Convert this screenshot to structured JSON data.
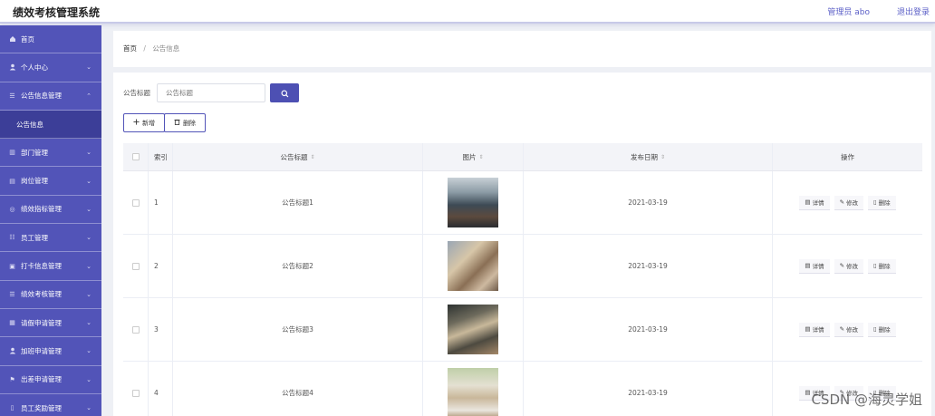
{
  "header": {
    "title": "绩效考核管理系统",
    "admin_text": "管理员 abo",
    "logout_label": "退出登录"
  },
  "sidebar": {
    "items": [
      {
        "label": "首页",
        "icon": "home-icon",
        "has_arrow": false,
        "sub": false
      },
      {
        "label": "个人中心",
        "icon": "user-icon",
        "has_arrow": true,
        "sub": false
      },
      {
        "label": "公告信息管理",
        "icon": "list-icon",
        "has_arrow": true,
        "sub": false,
        "expanded": true
      },
      {
        "label": "公告信息",
        "icon": "",
        "has_arrow": false,
        "sub": true
      },
      {
        "label": "部门管理",
        "icon": "building-icon",
        "has_arrow": true,
        "sub": false
      },
      {
        "label": "岗位管理",
        "icon": "briefcase-icon",
        "has_arrow": true,
        "sub": false
      },
      {
        "label": "绩效指标管理",
        "icon": "target-icon",
        "has_arrow": true,
        "sub": false
      },
      {
        "label": "员工管理",
        "icon": "people-icon",
        "has_arrow": true,
        "sub": false
      },
      {
        "label": "打卡信息管理",
        "icon": "clock-icon",
        "has_arrow": true,
        "sub": false
      },
      {
        "label": "绩效考核管理",
        "icon": "list-icon",
        "has_arrow": true,
        "sub": false
      },
      {
        "label": "请假申请管理",
        "icon": "calendar-icon",
        "has_arrow": true,
        "sub": false
      },
      {
        "label": "加班申请管理",
        "icon": "user-icon",
        "has_arrow": true,
        "sub": false
      },
      {
        "label": "出差申请管理",
        "icon": "flag-icon",
        "has_arrow": true,
        "sub": false
      },
      {
        "label": "员工奖励管理",
        "icon": "gift-icon",
        "has_arrow": true,
        "sub": false
      }
    ]
  },
  "breadcrumb": {
    "home": "首页",
    "separator": "/",
    "current": "公告信息"
  },
  "search": {
    "label": "公告标题",
    "placeholder": "公告标题"
  },
  "toolbar": {
    "add_label": "新增",
    "delete_label": "删除"
  },
  "table": {
    "columns": {
      "index": "索引",
      "title": "公告标题",
      "image": "图片",
      "date": "发布日期",
      "ops": "操作"
    },
    "rows": [
      {
        "index": "1",
        "title": "公告标题1",
        "date": "2021-03-19"
      },
      {
        "index": "2",
        "title": "公告标题2",
        "date": "2021-03-19"
      },
      {
        "index": "3",
        "title": "公告标题3",
        "date": "2021-03-19"
      },
      {
        "index": "4",
        "title": "公告标题4",
        "date": "2021-03-19"
      }
    ],
    "row_actions": {
      "detail": "详情",
      "edit": "修改",
      "delete": "删除"
    }
  },
  "watermark": "CSDN @海灵学姐",
  "colors": {
    "sidebar_bg": "#5254b8",
    "sidebar_active": "#3c3e98",
    "primary": "#4d50b3"
  }
}
